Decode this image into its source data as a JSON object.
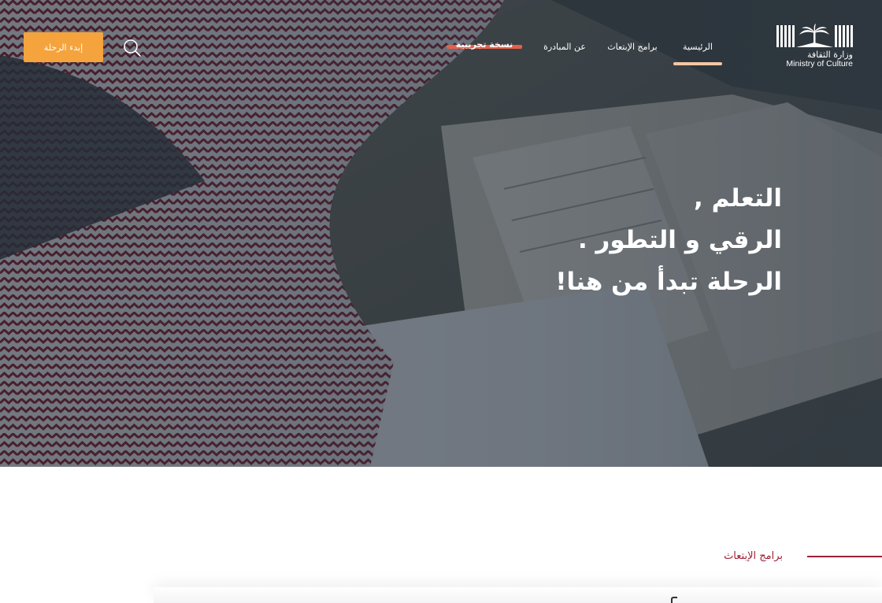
{
  "brand": {
    "name_ar": "وزارة الثقافة",
    "name_en": "Ministry of Culture",
    "logo_icon": "palm-tree-book-icon"
  },
  "nav": {
    "items": [
      {
        "label": "الرئيسية",
        "active": true
      },
      {
        "label": "برامج الإبتعاث",
        "active": false
      },
      {
        "label": "عن المبادرة",
        "active": false
      }
    ],
    "beta_label": "نسخة تجريبية",
    "search_icon": "search-icon",
    "start_button": "إبدء الرحلة"
  },
  "hero": {
    "line1": "التعلم ,",
    "line2": "الرقي و التطور .",
    "line3": "الرحلة تبدأ من هنا!"
  },
  "section": {
    "label": "برامج الإبتعاث"
  },
  "colors": {
    "accent_orange": "#f5a33c",
    "beta_red": "#e4604a",
    "active_underline": "#f5c6a5",
    "section_maroon": "#9b2136"
  }
}
